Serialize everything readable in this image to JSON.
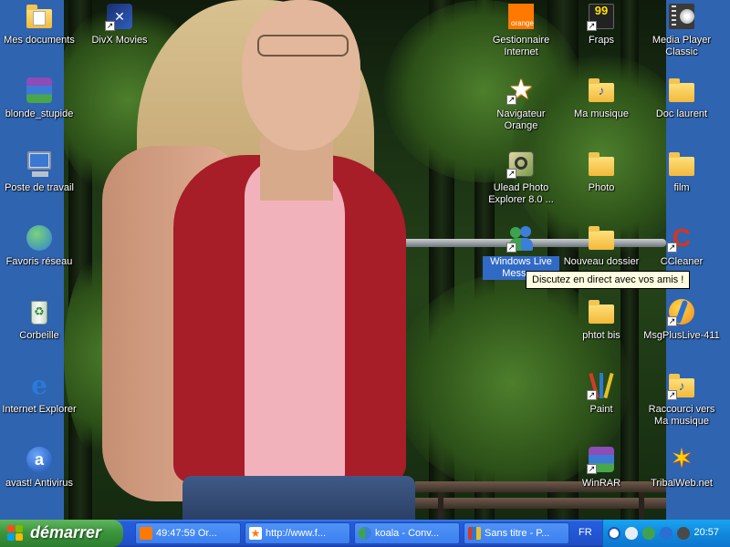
{
  "desktop": {
    "icons_left": [
      {
        "label": "Mes documents",
        "icon": "my-documents-icon"
      },
      {
        "label": "blonde_stupide",
        "icon": "winrar-archive-icon"
      },
      {
        "label": "Poste de travail",
        "icon": "my-computer-icon"
      },
      {
        "label": "Favoris réseau",
        "icon": "network-places-icon"
      },
      {
        "label": "Corbeille",
        "icon": "recycle-bin-icon"
      },
      {
        "label": "Internet Explorer",
        "icon": "internet-explorer-icon"
      },
      {
        "label": "avast! Antivirus",
        "icon": "avast-icon"
      }
    ],
    "icon_divx": {
      "label": "DivX Movies",
      "icon": "divx-icon"
    },
    "icons_col1": [
      {
        "label": "Gestionnaire\nInternet",
        "icon": "orange-icon"
      },
      {
        "label": "Navigateur\nOrange",
        "icon": "orange-browser-icon"
      },
      {
        "label": "Ulead Photo\nExplorer 8.0 ...",
        "icon": "ulead-icon"
      },
      {
        "label": "Windows Live\nMesse...",
        "icon": "windows-live-messenger-icon"
      }
    ],
    "icons_col2": [
      {
        "label": "Fraps",
        "icon": "fraps-icon",
        "badge": "99"
      },
      {
        "label": "Ma musique",
        "icon": "music-folder-icon"
      },
      {
        "label": "Photo",
        "icon": "folder-icon"
      },
      {
        "label": "Nouveau dossier",
        "icon": "folder-icon"
      },
      {
        "label": "phtot bis",
        "icon": "folder-icon"
      },
      {
        "label": "Paint",
        "icon": "paint-icon"
      },
      {
        "label": "WinRAR",
        "icon": "winrar-icon"
      }
    ],
    "icons_col3": [
      {
        "label": "Media Player\nClassic",
        "icon": "media-player-classic-icon"
      },
      {
        "label": "Doc laurent",
        "icon": "folder-icon"
      },
      {
        "label": "film",
        "icon": "folder-icon"
      },
      {
        "label": "CCleaner",
        "icon": "ccleaner-icon"
      },
      {
        "label": "MsgPlusLive-411",
        "icon": "msgplus-icon"
      },
      {
        "label": "Raccourci vers\nMa musique",
        "icon": "music-folder-shortcut-icon"
      },
      {
        "label": "TribalWeb.net",
        "icon": "tribalweb-icon"
      }
    ],
    "orange_badge": "orange",
    "tooltip": "Discutez en direct avec vos amis !"
  },
  "taskbar": {
    "start_label": "démarrer",
    "tasks": [
      {
        "label": "49:47:59 Or...",
        "icon": "orange-icon"
      },
      {
        "label": "http://www.f...",
        "icon": "orange-browser-icon"
      },
      {
        "label": "koala - Conv...",
        "icon": "messenger-icon"
      },
      {
        "label": "Sans titre - P...",
        "icon": "paint-icon"
      }
    ],
    "language": "FR",
    "clock": "20:57"
  },
  "colors": {
    "taskbar_blue": "#245edb",
    "start_green": "#3c963d",
    "tray_blue": "#1189dd",
    "selection_blue": "#316ac5",
    "tooltip_bg": "#ffffe1"
  }
}
